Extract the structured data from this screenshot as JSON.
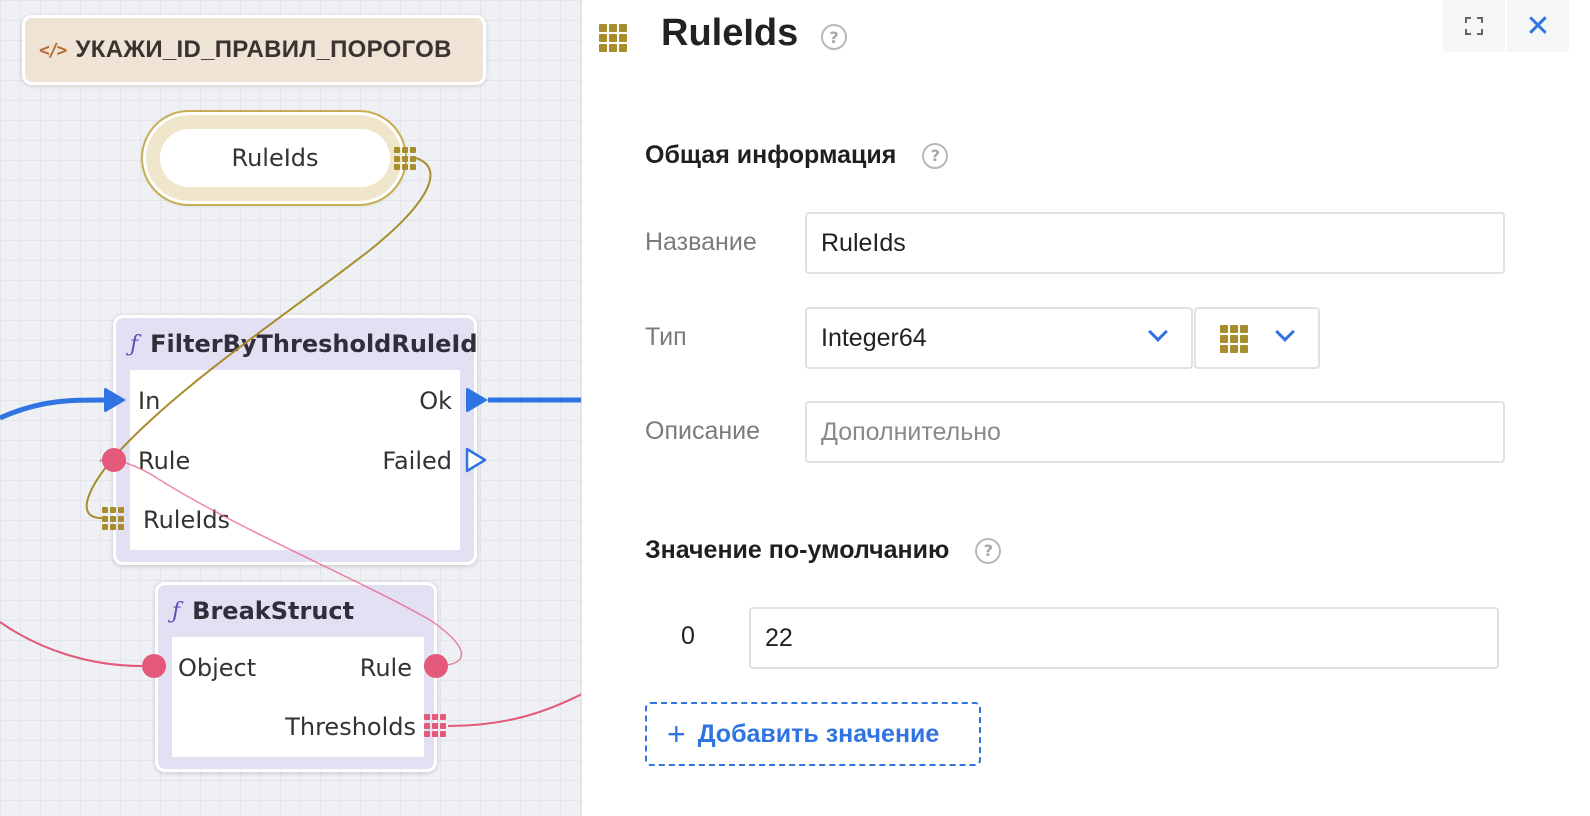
{
  "canvas": {
    "comment_node": {
      "icon": "code-icon",
      "title": "УКАЖИ_ID_ПРАВИЛ_ПОРОГОВ"
    },
    "variable_node": {
      "label": "RuleIds",
      "icon": "grid-icon"
    },
    "filter_node": {
      "title": "FilterByThresholdRuleId",
      "icon": "function-icon",
      "inputs": [
        "In",
        "Rule",
        "RuleIds"
      ],
      "outputs": [
        "Ok",
        "Failed"
      ]
    },
    "break_node": {
      "title": "BreakStruct",
      "icon": "function-icon",
      "inputs": [
        "Object"
      ],
      "outputs": [
        "Rule",
        "Thresholds"
      ]
    }
  },
  "panel": {
    "title": "RuleIds",
    "title_icon": "grid-icon",
    "section_general": "Общая информация",
    "name_label": "Название",
    "name_value": "RuleIds",
    "type_label": "Тип",
    "type_value": "Integer64",
    "description_label": "Описание",
    "description_placeholder": "Дополнительно",
    "section_default": "Значение по-умолчанию",
    "default_values": [
      {
        "index": "0",
        "value": "22"
      }
    ],
    "add_value_label": "Добавить значение",
    "close_symbol": "✕",
    "help_symbol": "?"
  },
  "colors": {
    "exec": "#2f74e0",
    "struct": "#e45879",
    "array": "#a88d2c",
    "accent": "#2f74e0"
  }
}
